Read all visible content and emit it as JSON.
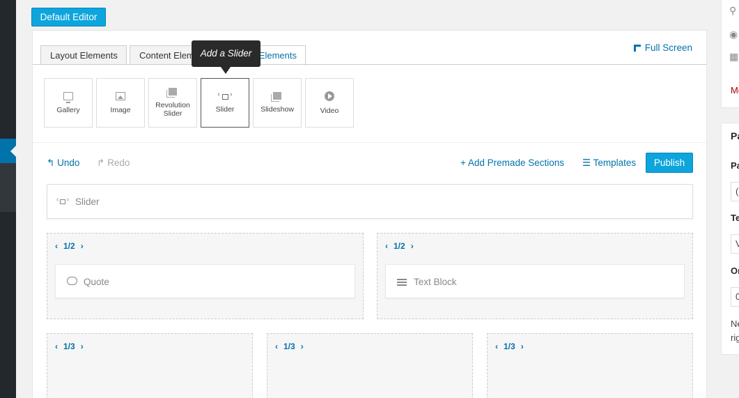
{
  "default_editor_label": "Default Editor",
  "tabs": [
    {
      "label": "Layout Elements"
    },
    {
      "label": "Content Elements"
    },
    {
      "label": "Media Elements"
    }
  ],
  "fullscreen_label": "Full Screen",
  "tooltip": "Add a Slider",
  "media_elements": [
    {
      "label": "Gallery",
      "icon": "monitor-icon"
    },
    {
      "label": "Image",
      "icon": "image-icon"
    },
    {
      "label": "Revolution Slider",
      "icon": "stack-icon"
    },
    {
      "label": "Slider",
      "icon": "slider-icon"
    },
    {
      "label": "Slideshow",
      "icon": "stack-icon"
    },
    {
      "label": "Video",
      "icon": "play-icon"
    }
  ],
  "toolbar": {
    "undo": "Undo",
    "redo": "Redo",
    "premade": "Add Premade Sections",
    "templates": "Templates",
    "publish": "Publish"
  },
  "canvas": {
    "slider_label": "Slider",
    "row1": [
      {
        "fraction": "1/2",
        "element": "Quote"
      },
      {
        "fraction": "1/2",
        "element": "Text Block"
      }
    ],
    "row2": [
      {
        "fraction": "1/3"
      },
      {
        "fraction": "1/3"
      },
      {
        "fraction": "1/3"
      }
    ]
  },
  "right_sidebar": {
    "panel1_link": "Mo",
    "panel2_title": "Pa",
    "field1_label": "Pa",
    "field1_value": "(",
    "field2_label": "Te",
    "field2_value": "V",
    "field3_label": "Or",
    "field3_value": "0",
    "note_line1": "Ne",
    "note_line2": "rig"
  }
}
